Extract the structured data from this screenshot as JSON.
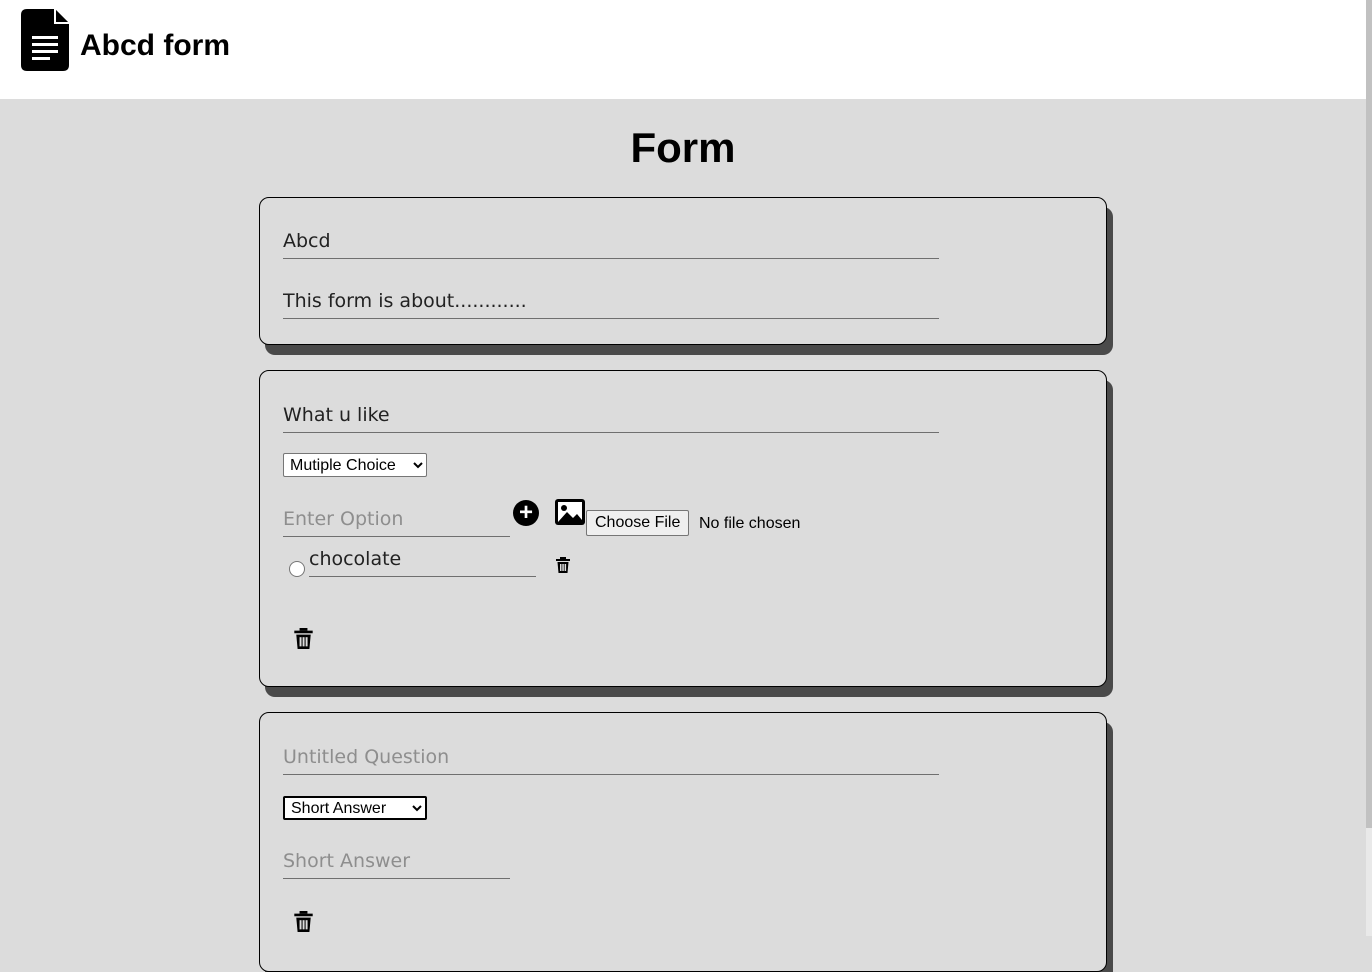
{
  "header": {
    "app_title": "Abcd form",
    "logo_icon": "document-icon"
  },
  "page_title": "Form",
  "form_info": {
    "title_value": "Abcd",
    "description_value": "This form is about............"
  },
  "questions": [
    {
      "question_value": "What u like",
      "type_selected": "Mutiple Choice",
      "option_placeholder": "Enter Option",
      "add_icon": "plus-circle-icon",
      "image_icon": "image-icon",
      "file_button_label": "Choose File",
      "file_status": "No file chosen",
      "options": [
        {
          "value": "chocolate",
          "delete_icon": "trash-icon"
        }
      ],
      "delete_icon": "trash-icon"
    },
    {
      "question_placeholder": "Untitled Question",
      "type_selected": "Short Answer",
      "answer_placeholder": "Short Answer",
      "delete_icon": "trash-icon"
    }
  ]
}
